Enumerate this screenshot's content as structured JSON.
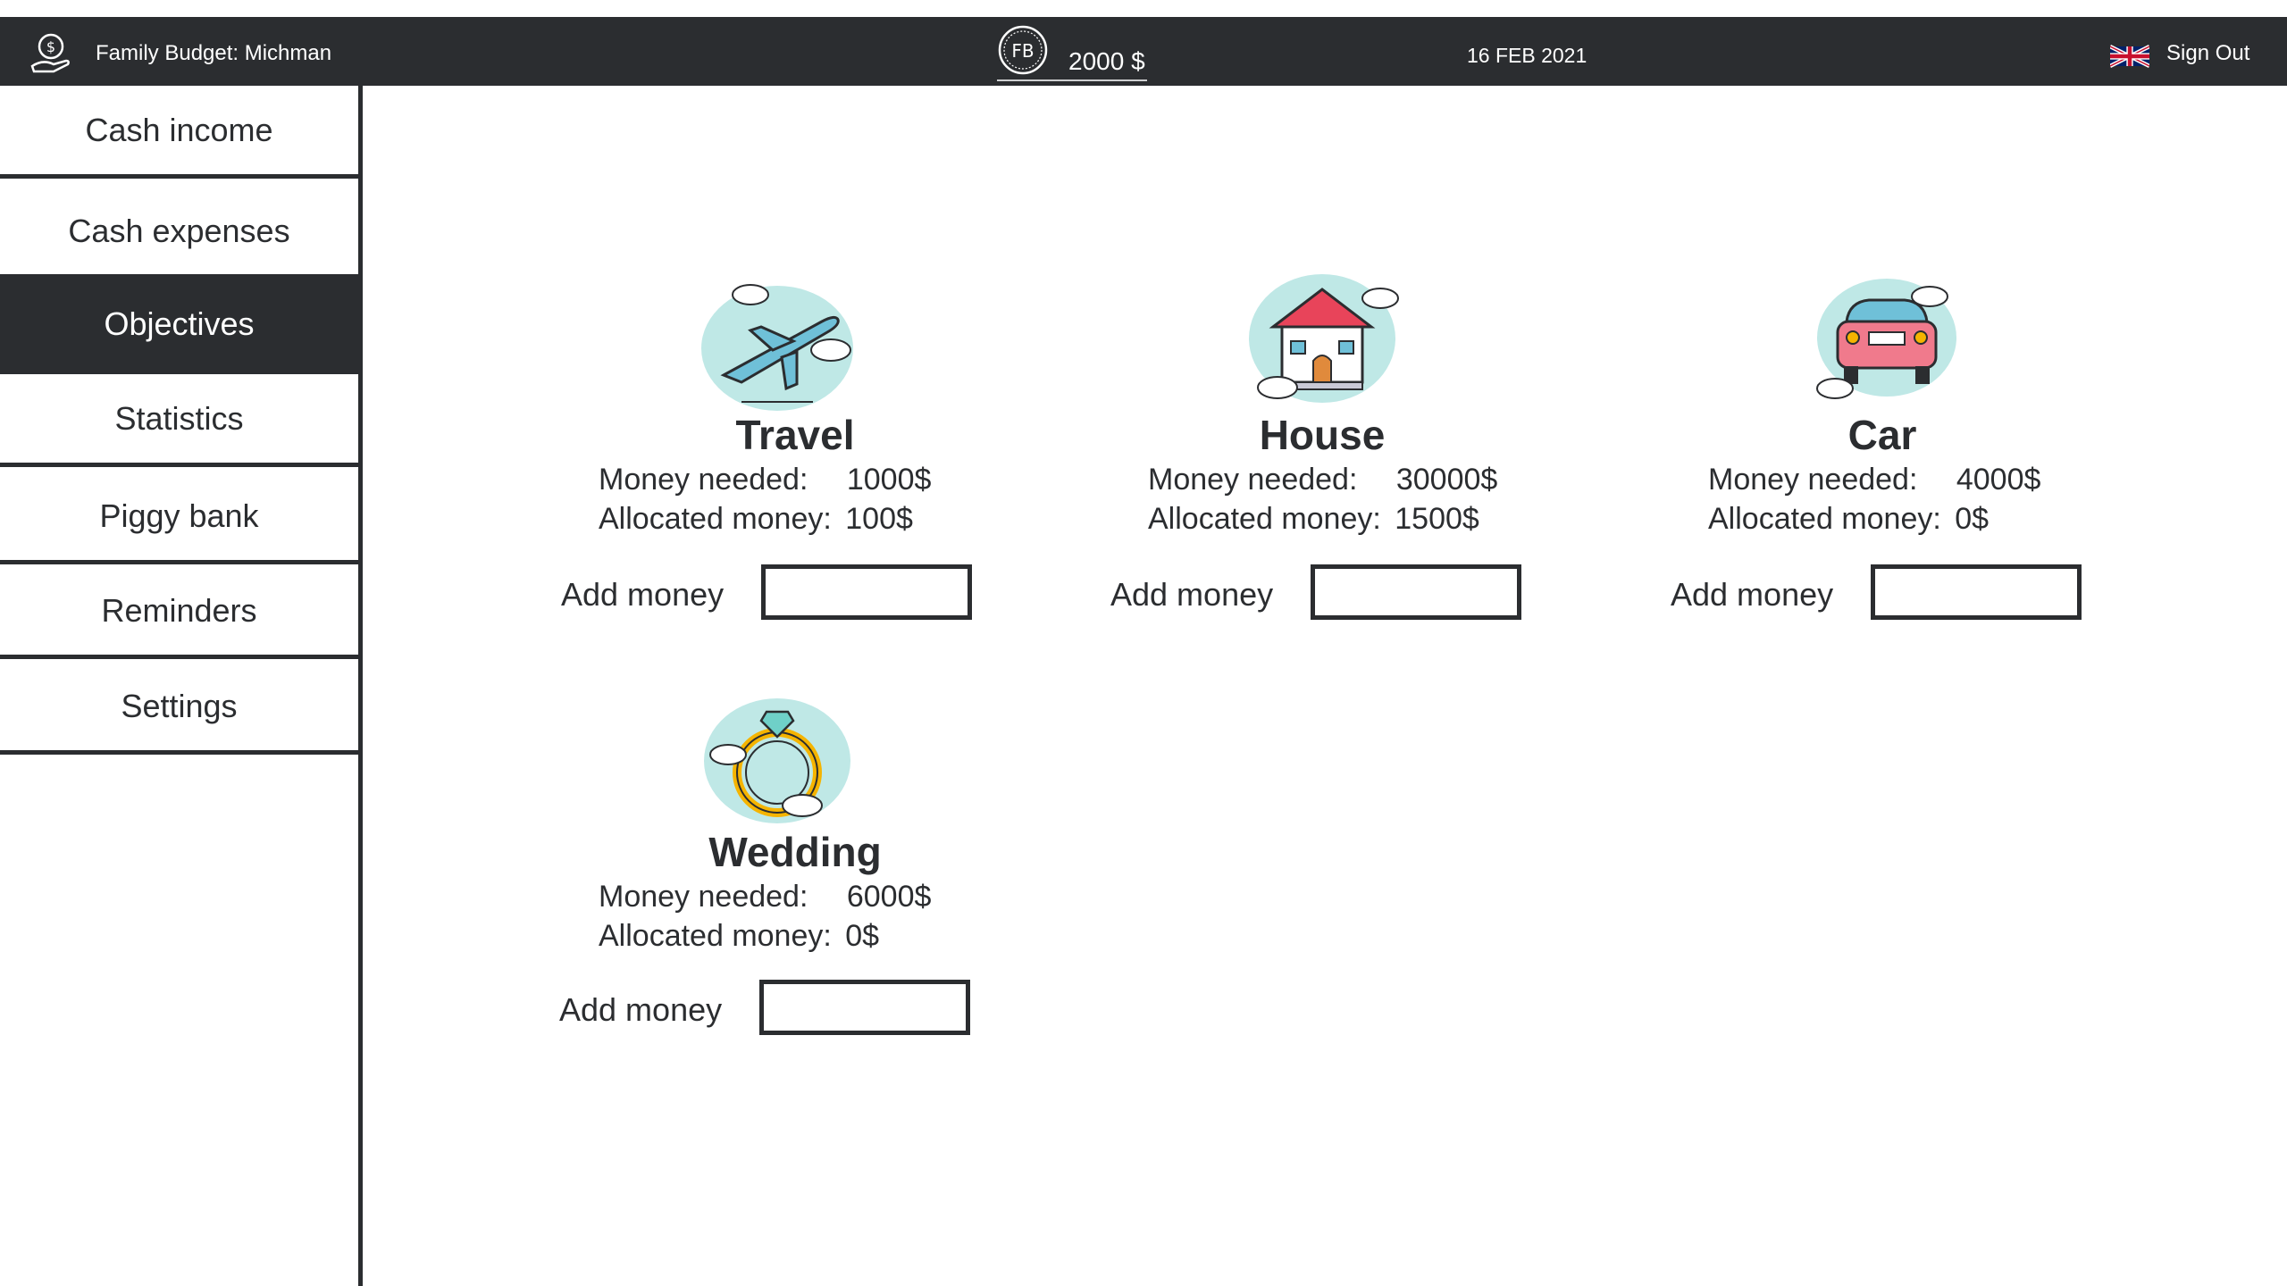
{
  "header": {
    "app_title": "Family Budget: Michman",
    "coin_label": "FB",
    "balance": "2000 $",
    "date": "16 FEB 2021",
    "language_icon": "uk-flag-icon",
    "sign_out": "Sign Out"
  },
  "sidebar": {
    "items": [
      {
        "label": "Cash income",
        "active": false
      },
      {
        "label": "Cash expenses",
        "active": false
      },
      {
        "label": "Objectives",
        "active": true
      },
      {
        "label": "Statistics",
        "active": false
      },
      {
        "label": "Piggy bank",
        "active": false
      },
      {
        "label": "Reminders",
        "active": false
      },
      {
        "label": "Settings",
        "active": false
      }
    ]
  },
  "objectives": [
    {
      "name": "Travel",
      "needed_label": "Money needed:",
      "needed": "1000$",
      "allocated_label": "Allocated money:",
      "allocated": "100$",
      "add_label": "Add money",
      "icon": "airplane-icon"
    },
    {
      "name": "House",
      "needed_label": "Money needed:",
      "needed": "30000$",
      "allocated_label": "Allocated money:",
      "allocated": "1500$",
      "add_label": "Add money",
      "icon": "house-icon"
    },
    {
      "name": "Car",
      "needed_label": "Money needed:",
      "needed": "4000$",
      "allocated_label": "Allocated money:",
      "allocated": "0$",
      "add_label": "Add money",
      "icon": "car-icon"
    },
    {
      "name": "Wedding",
      "needed_label": "Money needed:",
      "needed": "6000$",
      "allocated_label": "Allocated money:",
      "allocated": "0$",
      "add_label": "Add money",
      "icon": "ring-icon"
    }
  ],
  "colors": {
    "dark": "#2b2d30",
    "cloud": "#bfe8e6",
    "accent_red": "#e8445a",
    "accent_gold": "#f5b400"
  }
}
